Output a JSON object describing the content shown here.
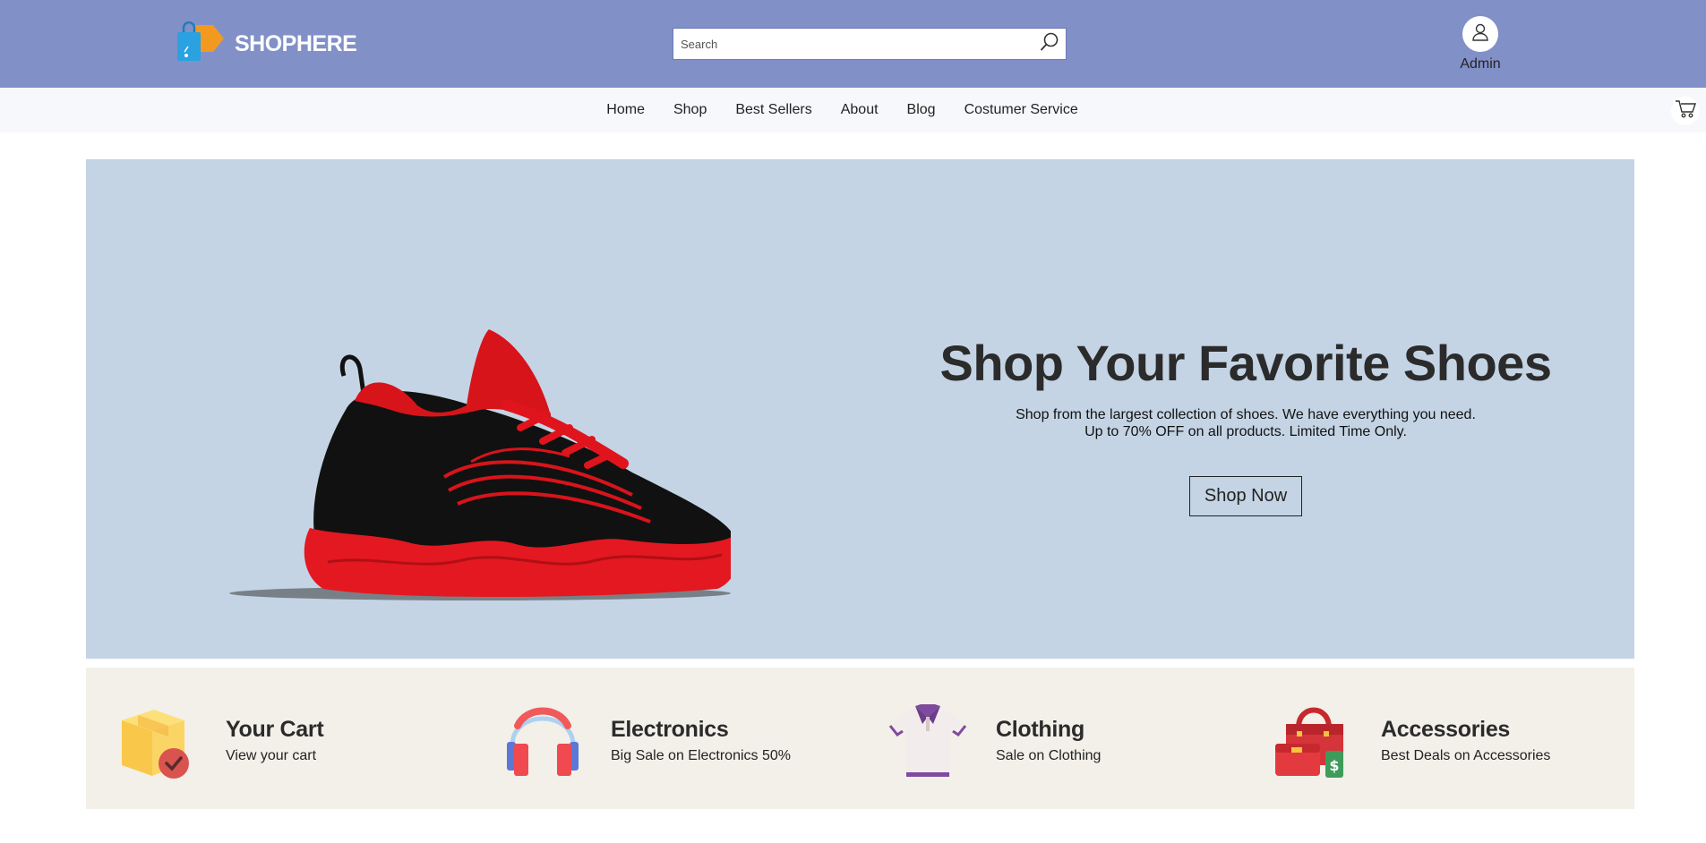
{
  "header": {
    "brand": "SHOPHERE",
    "search_placeholder": "Search",
    "account_label": "Admin"
  },
  "nav": {
    "items": [
      {
        "label": "Home"
      },
      {
        "label": "Shop"
      },
      {
        "label": "Best Sellers"
      },
      {
        "label": "About"
      },
      {
        "label": "Blog"
      },
      {
        "label": "Costumer Service"
      }
    ]
  },
  "hero": {
    "title": "Shop Your Favorite Shoes",
    "subtitle_line1": "Shop from the largest collection of shoes. We have everything you need.",
    "subtitle_line2": "Up to 70% OFF on all products. Limited Time Only.",
    "cta_label": "Shop Now",
    "background_color": "#c4d4e4"
  },
  "categories": [
    {
      "title": "Your Cart",
      "subtitle": "View your cart",
      "icon": "box-check-icon"
    },
    {
      "title": "Electronics",
      "subtitle": "Big Sale on Electronics 50%",
      "icon": "headphones-icon"
    },
    {
      "title": "Clothing",
      "subtitle": "Sale on Clothing",
      "icon": "shirt-icon"
    },
    {
      "title": "Accessories",
      "subtitle": "Best Deals on Accessories",
      "icon": "handbag-icon"
    }
  ],
  "colors": {
    "header_bg": "#8290c8",
    "nav_bg": "#f6f8fc",
    "categories_bg": "#f2f0e8"
  }
}
